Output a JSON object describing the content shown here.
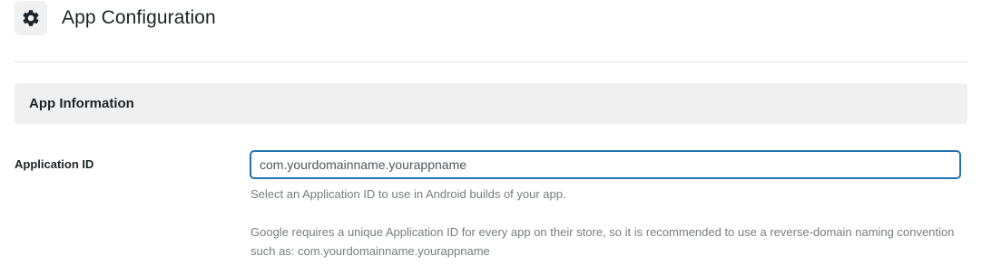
{
  "header": {
    "icon": "gear-icon",
    "title": "App Configuration"
  },
  "section": {
    "title": "App Information"
  },
  "application_id": {
    "label": "Application ID",
    "placeholder": "com.yourdomainname.yourappname",
    "value": "",
    "help_primary": "Select an Application ID to use in Android builds of your app.",
    "help_secondary": "Google requires a unique Application ID for every app on their store, so it is recommended to use a reverse-domain naming convention such as: com.yourdomainname.yourappname"
  },
  "colors": {
    "focus_border": "#2271b1",
    "section_bg": "#f0f0f1",
    "help_text": "#787c82"
  }
}
